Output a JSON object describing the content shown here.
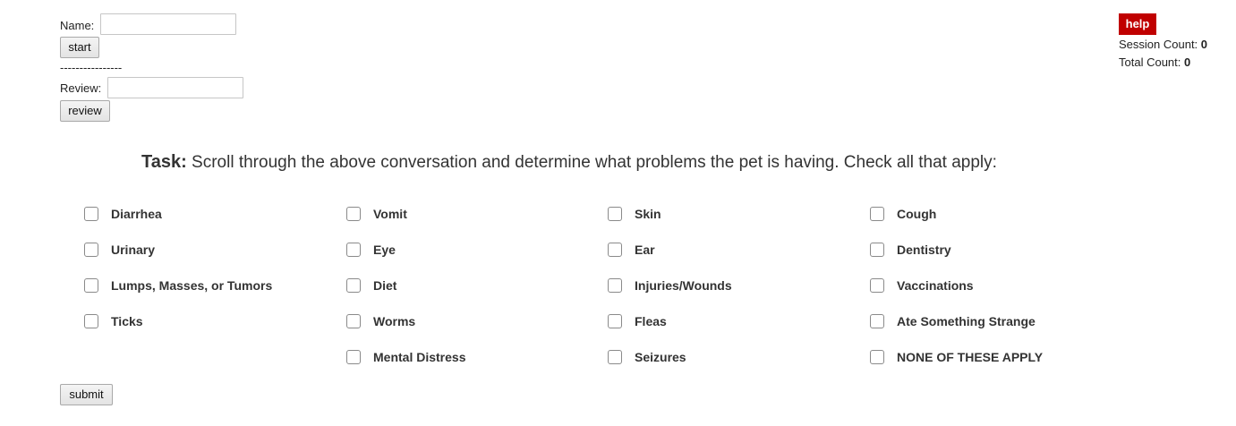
{
  "form": {
    "name_label": "Name:",
    "name_value": "",
    "start_label": "start",
    "divider": "----------------",
    "review_label": "Review:",
    "review_value": "",
    "review_button": "review",
    "submit_label": "submit"
  },
  "stats": {
    "help_label": "help",
    "session_label": "Session Count:",
    "session_value": "0",
    "total_label": "Total Count:",
    "total_value": "0"
  },
  "task": {
    "heading": "Task:",
    "text": "Scroll through the above conversation and determine what problems the pet is having. Check all that apply:"
  },
  "options": [
    {
      "label": "Diarrhea",
      "checked": false
    },
    {
      "label": "Vomit",
      "checked": false
    },
    {
      "label": "Skin",
      "checked": false
    },
    {
      "label": "Cough",
      "checked": false
    },
    {
      "label": "Urinary",
      "checked": false
    },
    {
      "label": "Eye",
      "checked": false
    },
    {
      "label": "Ear",
      "checked": false
    },
    {
      "label": "Dentistry",
      "checked": false
    },
    {
      "label": "Lumps, Masses, or Tumors",
      "checked": false
    },
    {
      "label": "Diet",
      "checked": false
    },
    {
      "label": "Injuries/Wounds",
      "checked": false
    },
    {
      "label": "Vaccinations",
      "checked": false
    },
    {
      "label": "Ticks",
      "checked": false
    },
    {
      "label": "Worms",
      "checked": false
    },
    {
      "label": "Fleas",
      "checked": false
    },
    {
      "label": "Ate Something Strange",
      "checked": false
    },
    {
      "label": "Mental Distress",
      "checked": false
    },
    {
      "label": "Seizures",
      "checked": false
    },
    {
      "label": "NONE OF THESE APPLY",
      "checked": false
    }
  ],
  "colors": {
    "help_background": "#c00000"
  }
}
